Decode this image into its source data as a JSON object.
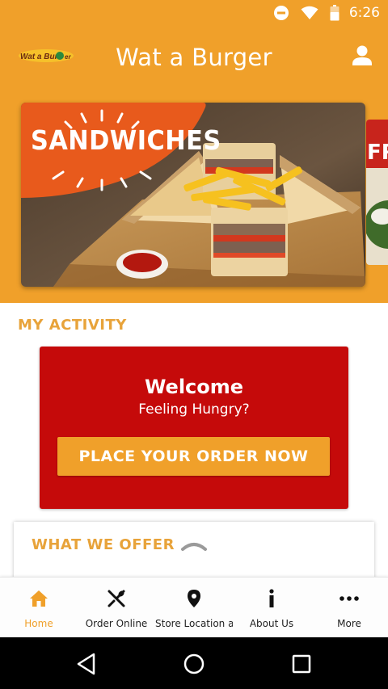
{
  "status_bar": {
    "time": "6:26",
    "icons": [
      "do-not-disturb-icon",
      "wifi-icon",
      "battery-icon"
    ]
  },
  "app_bar": {
    "logo_text": "Wat a Burger",
    "title": "Wat a Burger",
    "profile_icon": "person-icon"
  },
  "banner": {
    "current_label": "SANDWICHES",
    "next_label": "FR"
  },
  "activity": {
    "heading": "MY ACTIVITY",
    "welcome_title": "Welcome",
    "welcome_subtitle": "Feeling Hungry?",
    "order_button": "PLACE YOUR ORDER NOW"
  },
  "offer": {
    "heading": "WHAT WE OFFER",
    "toggle_icon": "chevron-up-icon"
  },
  "bottom_nav": {
    "items": [
      {
        "label": "Home",
        "icon": "home-icon",
        "active": true
      },
      {
        "label": "Order Online",
        "icon": "fork-knife-icon",
        "active": false
      },
      {
        "label": "Store Location a...",
        "icon": "location-pin-icon",
        "active": false
      },
      {
        "label": "About Us",
        "icon": "info-icon",
        "active": false
      },
      {
        "label": "More",
        "icon": "more-dots-icon",
        "active": false
      }
    ]
  },
  "colors": {
    "brand_orange": "#f0a02a",
    "heading_orange": "#e8a33a",
    "card_red": "#c50a0a",
    "banner_badge": "#e85a1c"
  }
}
